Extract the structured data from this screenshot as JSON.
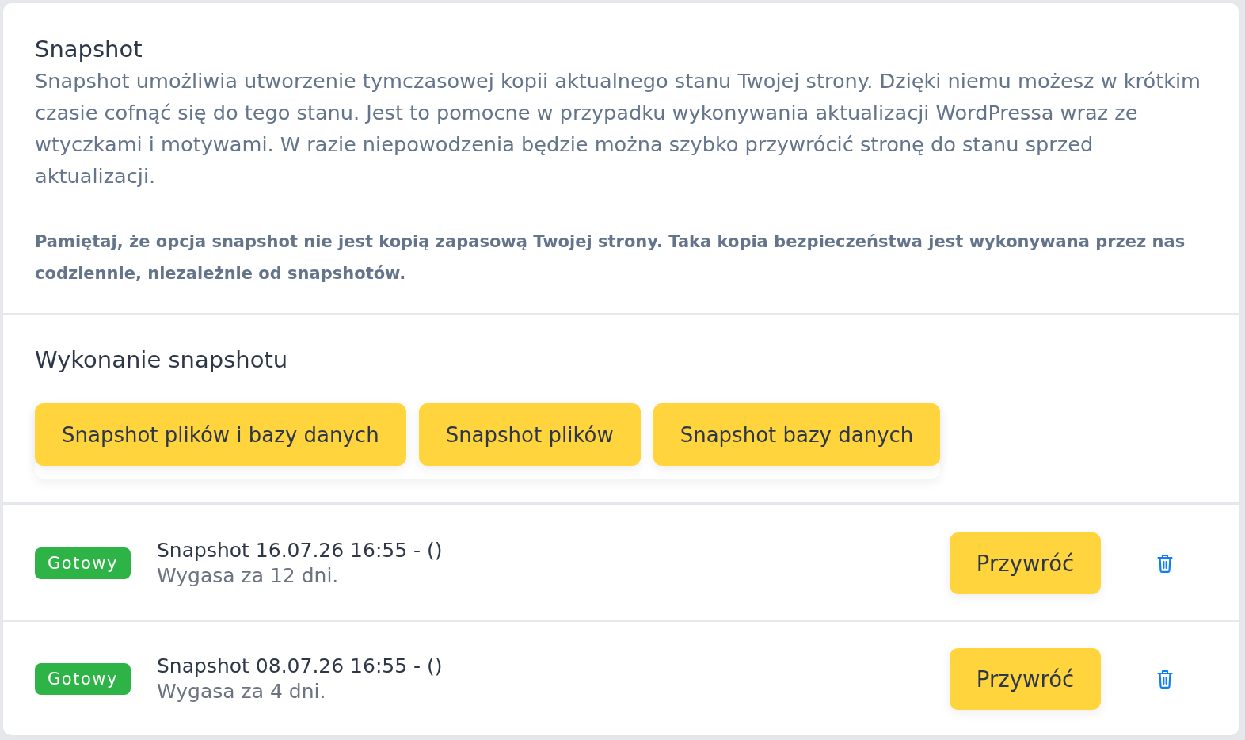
{
  "intro": {
    "title": "Snapshot",
    "description": "Snapshot umożliwia utworzenie tymczasowej kopii aktualnego stanu Twojej strony. Dzięki niemu możesz w krótkim czasie cofnąć się do tego stanu. Jest to pomocne w przypadku wykonywania aktualizacji WordPressa wraz ze wtyczkami i motywami. W razie niepowodzenia będzie można szybko przywrócić stronę do stanu sprzed aktualizacji.",
    "note": "Pamiętaj, że opcja snapshot nie jest kopią zapasową Twojej strony. Taka kopia bezpieczeństwa jest wykonywana przez nas codziennie, niezależnie od snapshotów."
  },
  "create": {
    "title": "Wykonanie snapshotu",
    "buttons": [
      "Snapshot plików i bazy danych",
      "Snapshot plików",
      "Snapshot bazy danych"
    ]
  },
  "snapshots": [
    {
      "status": "Gotowy",
      "color": "#2eb346",
      "title": "Snapshot 16.07.26 16:55 - ()",
      "expires": "Wygasa za 12 dni.",
      "restore": "Przywróć"
    },
    {
      "status": "Gotowy",
      "color": "#2eb346",
      "title": "Snapshot 08.07.26 16:55 - ()",
      "expires": "Wygasa za 4 dni.",
      "restore": "Przywróć"
    }
  ]
}
